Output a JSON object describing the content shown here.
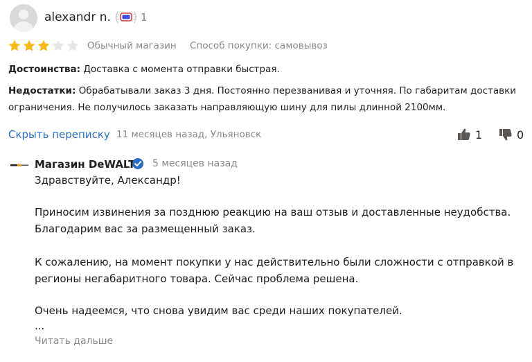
{
  "review": {
    "username": "alexandr n.",
    "level": "1",
    "rating": 3,
    "rating_max": 5,
    "shop_type": "Обычный магазин",
    "purchase_method": "Способ покупки: самовывоз",
    "pros_label": "Достоинства:",
    "pros_text": " Доставка с момента отправки быстрая.",
    "cons_label": "Недостатки:",
    "cons_text_line1": " Обрабатывали заказ 3 дня. Постоянно перезванивая и уточняя. По габаритам доставки",
    "cons_text_line2": "ограничения. Не получилось заказать направляющую шину для пилы длинной 2100мм.",
    "hide_thread_link": "Скрыть переписку",
    "date_location": "11 месяцев назад, Ульяновск",
    "likes": "1",
    "dislikes": "0"
  },
  "shop_reply": {
    "name": "Магазин DeWALT",
    "date": "5 месяцев назад",
    "lines": [
      "Здравствуйте, Александр!",
      "Приносим извинения за позднюю реакцию на ваш отзыв и доставленные неудобства.",
      "Благодарим вас за размещенный заказ.",
      "К сожалению, на момент покупки у нас действительно были сложности с отправкой в",
      "регионы негабаритного товара. Сейчас проблема решена.",
      "Очень надеемся, что снова увидим вас среди наших покупателей.",
      "..."
    ],
    "read_more": "Читать дальше"
  },
  "colors": {
    "star_filled": "#fdb913",
    "star_empty": "#e6e6e6",
    "link": "#2a6dc9",
    "muted": "#8a8784",
    "verified": "#2a6dc9"
  },
  "icons": [
    "avatar-icon",
    "level-badge-icon",
    "star-icon",
    "thumbs-up-icon",
    "thumbs-down-icon",
    "shop-logo-icon",
    "verified-check-icon"
  ]
}
